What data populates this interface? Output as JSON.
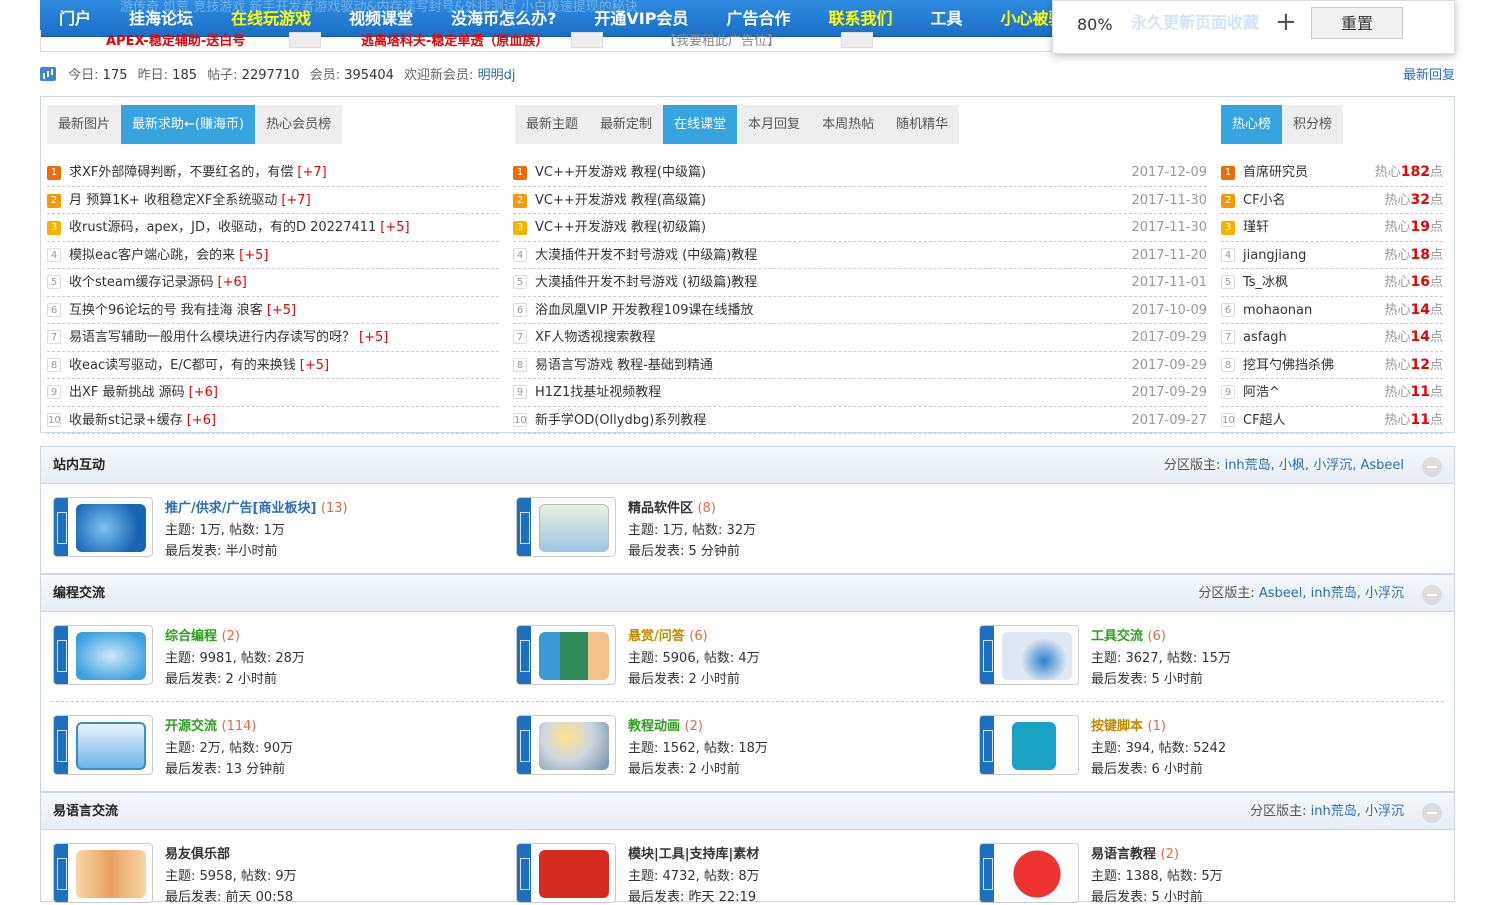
{
  "topnav": {
    "ghost_text": "游传奇    饥荒    竞技游戏            新手开发者游戏驱动&内存读写封号&外挂测试            小白极速提现的秘诀",
    "items": [
      "门户",
      "挂海论坛",
      "在线玩游戏",
      "视频课堂",
      "没海币怎么办?",
      "开通VIP会员",
      "广告合作",
      "联系我们",
      "工具",
      "小心被骗",
      "永久更新页面收藏"
    ],
    "highlight_color": "#ffff00"
  },
  "adrow": {
    "ad1": "APEX-稳定辅助-送白号",
    "ad2": "逃离塔科夫-稳定单透（原血族）",
    "ad3": "【我要租此广告位】"
  },
  "zoom": {
    "value": "80%",
    "plus": "+",
    "reset": "重置",
    "tip": "永久更新页面收藏"
  },
  "stats": {
    "today_label": "今日:",
    "today": "175",
    "yesterday_label": "昨日:",
    "yesterday": "185",
    "posts_label": "帖子:",
    "posts": "2297710",
    "members_label": "会员:",
    "members": "395404",
    "welcome_label": "欢迎新会员:",
    "newest": "明明dj",
    "latest_reply": "最新回复"
  },
  "hot": {
    "left_tabs": [
      "最新图片",
      "最新求助←(赚海币)",
      "热心会员榜"
    ],
    "mid_tabs": [
      "最新主题",
      "最新定制",
      "在线课堂",
      "本月回复",
      "本周热帖",
      "随机精华"
    ],
    "right_tabs": [
      "热心榜",
      "积分榜"
    ],
    "left_list": [
      {
        "n": "1",
        "title": "求XF外部障碍判断，不要红名的，有偿",
        "bonus": "[+7]"
      },
      {
        "n": "2",
        "title": "月 预算1K+ 收租稳定XF全系统驱动",
        "bonus": "[+7]"
      },
      {
        "n": "3",
        "title": "收rust源码，apex，JD，收驱动，有的D 20227411",
        "bonus": "[+5]"
      },
      {
        "n": "4",
        "title": "模拟eac客户端心跳，会的来",
        "bonus": "[+5]"
      },
      {
        "n": "5",
        "title": "收个steam缓存记录源码",
        "bonus": "[+6]"
      },
      {
        "n": "6",
        "title": "互换个96论坛的号 我有挂海 浪客",
        "bonus": "[+5]"
      },
      {
        "n": "7",
        "title": "易语言写辅助一般用什么模块进行内存读写的呀？",
        "bonus": "[+5]"
      },
      {
        "n": "8",
        "title": "收eac读写驱动，E/C都可，有的来换钱",
        "bonus": "[+5]"
      },
      {
        "n": "9",
        "title": "出XF 最新挑战 源码",
        "bonus": "[+6]"
      },
      {
        "n": "10",
        "title": "收最新st记录+缓存",
        "bonus": "[+6]"
      }
    ],
    "mid_list": [
      {
        "n": "1",
        "title": "VC++开发游戏 教程(中级篇)",
        "date": "2017-12-09"
      },
      {
        "n": "2",
        "title": "VC++开发游戏 教程(高级篇)",
        "date": "2017-11-30"
      },
      {
        "n": "3",
        "title": "VC++开发游戏 教程(初级篇)",
        "date": "2017-11-30"
      },
      {
        "n": "4",
        "title": "大漠插件开发不封号游戏 (中级篇)教程",
        "date": "2017-11-20"
      },
      {
        "n": "5",
        "title": "大漠插件开发不封号游戏 (初级篇)教程",
        "date": "2017-11-01"
      },
      {
        "n": "6",
        "title": "浴血凤凰VIP 开发教程109课在线播放",
        "date": "2017-10-09"
      },
      {
        "n": "7",
        "title": "XF人物透视搜索教程",
        "date": "2017-09-29"
      },
      {
        "n": "8",
        "title": "易语言写游戏 教程-基础到精通",
        "date": "2017-09-29"
      },
      {
        "n": "9",
        "title": "H1Z1找基址视频教程",
        "date": "2017-09-29"
      },
      {
        "n": "10",
        "title": "新手学OD(Ollydbg)系列教程",
        "date": "2017-09-27"
      }
    ],
    "right_list": [
      {
        "n": "1",
        "name": "首席研究员",
        "heat": "182"
      },
      {
        "n": "2",
        "name": "CF小名",
        "heat": "32"
      },
      {
        "n": "3",
        "name": "瑾轩",
        "heat": "19"
      },
      {
        "n": "4",
        "name": "jiangjiang",
        "heat": "18"
      },
      {
        "n": "5",
        "name": "Ts_冰枫",
        "heat": "16"
      },
      {
        "n": "6",
        "name": "mohaonan",
        "heat": "14"
      },
      {
        "n": "7",
        "name": "asfagh",
        "heat": "14"
      },
      {
        "n": "8",
        "name": "挖耳勺佛挡杀佛",
        "heat": "12"
      },
      {
        "n": "9",
        "name": "阿浩^",
        "heat": "11"
      },
      {
        "n": "10",
        "name": "CF超人",
        "heat": "11"
      }
    ],
    "heat_prefix": "热心",
    "heat_suffix": "点"
  },
  "sections": [
    {
      "title": "站内互动",
      "mods_label": "分区版主:",
      "mods": "inh荒岛, 小枫, 小浮沉, Asbeel",
      "forums": [
        {
          "name": "推广/供求/广告[商业板块]",
          "count": "(13)",
          "stats": "主题: 1万, 帖数: 1万",
          "last": "最后发表: 半小时前"
        },
        {
          "name": "精品软件区",
          "count": "(8)",
          "stats": "主题: 1万, 帖数: 32万",
          "last": "最后发表: 5 分钟前"
        }
      ]
    },
    {
      "title": "编程交流",
      "mods_label": "分区版主:",
      "mods": "Asbeel, inh荒岛, 小浮沉",
      "forums": [
        {
          "name": "综合编程",
          "count": "(2)",
          "stats": "主题: 9981, 帖数: 28万",
          "last": "最后发表: 2 小时前"
        },
        {
          "name": "悬赏/问答",
          "count": "(6)",
          "stats": "主题: 5906, 帖数: 4万",
          "last": "最后发表: 2 小时前"
        },
        {
          "name": "工具交流",
          "count": "(6)",
          "stats": "主题: 3627, 帖数: 15万",
          "last": "最后发表: 5 小时前"
        },
        {
          "name": "开源交流",
          "count": "(114)",
          "stats": "主题: 2万, 帖数: 90万",
          "last": "最后发表: 13 分钟前"
        },
        {
          "name": "教程动画",
          "count": "(2)",
          "stats": "主题: 1562, 帖数: 18万",
          "last": "最后发表: 2 小时前"
        },
        {
          "name": "按键脚本",
          "count": "(1)",
          "stats": "主题: 394, 帖数: 5242",
          "last": "最后发表: 6 小时前"
        }
      ]
    },
    {
      "title": "易语言交流",
      "mods_label": "分区版主:",
      "mods": "inh荒岛, 小浮沉",
      "forums": [
        {
          "name": "易友俱乐部",
          "count": "",
          "stats": "主题: 5958, 帖数: 9万",
          "last": "最后发表: 前天 00:58"
        },
        {
          "name": "模块|工具|支持库|素材",
          "count": "",
          "stats": "主题: 4732, 帖数: 8万",
          "last": "最后发表: 昨天 22:19"
        },
        {
          "name": "易语言教程",
          "count": "(2)",
          "stats": "主题: 1388, 帖数: 5万",
          "last": "最后发表: 5 小时前"
        }
      ]
    }
  ]
}
